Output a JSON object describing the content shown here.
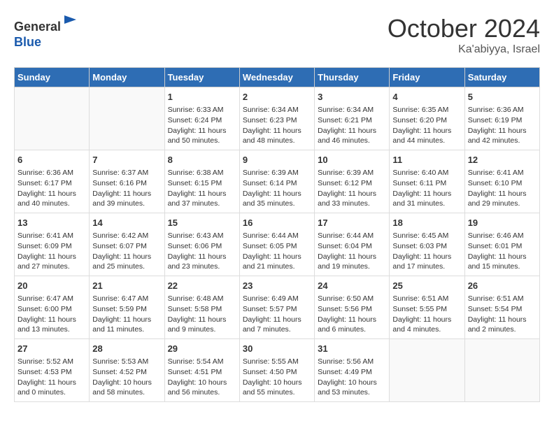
{
  "header": {
    "logo_line1": "General",
    "logo_line2": "Blue",
    "month": "October 2024",
    "location": "Ka'abiyya, Israel"
  },
  "weekdays": [
    "Sunday",
    "Monday",
    "Tuesday",
    "Wednesday",
    "Thursday",
    "Friday",
    "Saturday"
  ],
  "weeks": [
    [
      {
        "day": "",
        "info": ""
      },
      {
        "day": "",
        "info": ""
      },
      {
        "day": "1",
        "info": "Sunrise: 6:33 AM\nSunset: 6:24 PM\nDaylight: 11 hours and 50 minutes."
      },
      {
        "day": "2",
        "info": "Sunrise: 6:34 AM\nSunset: 6:23 PM\nDaylight: 11 hours and 48 minutes."
      },
      {
        "day": "3",
        "info": "Sunrise: 6:34 AM\nSunset: 6:21 PM\nDaylight: 11 hours and 46 minutes."
      },
      {
        "day": "4",
        "info": "Sunrise: 6:35 AM\nSunset: 6:20 PM\nDaylight: 11 hours and 44 minutes."
      },
      {
        "day": "5",
        "info": "Sunrise: 6:36 AM\nSunset: 6:19 PM\nDaylight: 11 hours and 42 minutes."
      }
    ],
    [
      {
        "day": "6",
        "info": "Sunrise: 6:36 AM\nSunset: 6:17 PM\nDaylight: 11 hours and 40 minutes."
      },
      {
        "day": "7",
        "info": "Sunrise: 6:37 AM\nSunset: 6:16 PM\nDaylight: 11 hours and 39 minutes."
      },
      {
        "day": "8",
        "info": "Sunrise: 6:38 AM\nSunset: 6:15 PM\nDaylight: 11 hours and 37 minutes."
      },
      {
        "day": "9",
        "info": "Sunrise: 6:39 AM\nSunset: 6:14 PM\nDaylight: 11 hours and 35 minutes."
      },
      {
        "day": "10",
        "info": "Sunrise: 6:39 AM\nSunset: 6:12 PM\nDaylight: 11 hours and 33 minutes."
      },
      {
        "day": "11",
        "info": "Sunrise: 6:40 AM\nSunset: 6:11 PM\nDaylight: 11 hours and 31 minutes."
      },
      {
        "day": "12",
        "info": "Sunrise: 6:41 AM\nSunset: 6:10 PM\nDaylight: 11 hours and 29 minutes."
      }
    ],
    [
      {
        "day": "13",
        "info": "Sunrise: 6:41 AM\nSunset: 6:09 PM\nDaylight: 11 hours and 27 minutes."
      },
      {
        "day": "14",
        "info": "Sunrise: 6:42 AM\nSunset: 6:07 PM\nDaylight: 11 hours and 25 minutes."
      },
      {
        "day": "15",
        "info": "Sunrise: 6:43 AM\nSunset: 6:06 PM\nDaylight: 11 hours and 23 minutes."
      },
      {
        "day": "16",
        "info": "Sunrise: 6:44 AM\nSunset: 6:05 PM\nDaylight: 11 hours and 21 minutes."
      },
      {
        "day": "17",
        "info": "Sunrise: 6:44 AM\nSunset: 6:04 PM\nDaylight: 11 hours and 19 minutes."
      },
      {
        "day": "18",
        "info": "Sunrise: 6:45 AM\nSunset: 6:03 PM\nDaylight: 11 hours and 17 minutes."
      },
      {
        "day": "19",
        "info": "Sunrise: 6:46 AM\nSunset: 6:01 PM\nDaylight: 11 hours and 15 minutes."
      }
    ],
    [
      {
        "day": "20",
        "info": "Sunrise: 6:47 AM\nSunset: 6:00 PM\nDaylight: 11 hours and 13 minutes."
      },
      {
        "day": "21",
        "info": "Sunrise: 6:47 AM\nSunset: 5:59 PM\nDaylight: 11 hours and 11 minutes."
      },
      {
        "day": "22",
        "info": "Sunrise: 6:48 AM\nSunset: 5:58 PM\nDaylight: 11 hours and 9 minutes."
      },
      {
        "day": "23",
        "info": "Sunrise: 6:49 AM\nSunset: 5:57 PM\nDaylight: 11 hours and 7 minutes."
      },
      {
        "day": "24",
        "info": "Sunrise: 6:50 AM\nSunset: 5:56 PM\nDaylight: 11 hours and 6 minutes."
      },
      {
        "day": "25",
        "info": "Sunrise: 6:51 AM\nSunset: 5:55 PM\nDaylight: 11 hours and 4 minutes."
      },
      {
        "day": "26",
        "info": "Sunrise: 6:51 AM\nSunset: 5:54 PM\nDaylight: 11 hours and 2 minutes."
      }
    ],
    [
      {
        "day": "27",
        "info": "Sunrise: 5:52 AM\nSunset: 4:53 PM\nDaylight: 11 hours and 0 minutes."
      },
      {
        "day": "28",
        "info": "Sunrise: 5:53 AM\nSunset: 4:52 PM\nDaylight: 10 hours and 58 minutes."
      },
      {
        "day": "29",
        "info": "Sunrise: 5:54 AM\nSunset: 4:51 PM\nDaylight: 10 hours and 56 minutes."
      },
      {
        "day": "30",
        "info": "Sunrise: 5:55 AM\nSunset: 4:50 PM\nDaylight: 10 hours and 55 minutes."
      },
      {
        "day": "31",
        "info": "Sunrise: 5:56 AM\nSunset: 4:49 PM\nDaylight: 10 hours and 53 minutes."
      },
      {
        "day": "",
        "info": ""
      },
      {
        "day": "",
        "info": ""
      }
    ]
  ]
}
